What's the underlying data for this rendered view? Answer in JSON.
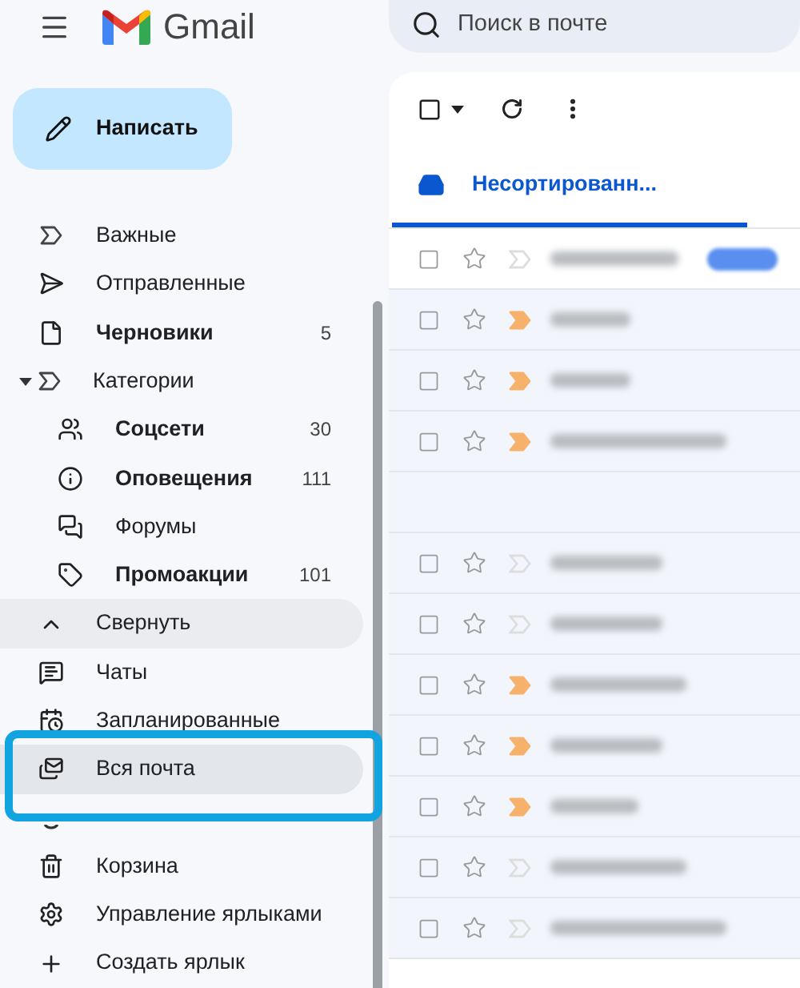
{
  "header": {
    "app_name": "Gmail",
    "search": {
      "placeholder": "Поиск в почте"
    }
  },
  "compose": {
    "label": "Написать"
  },
  "sidebar": {
    "items": [
      {
        "label": "Важные",
        "bold": false,
        "selected": false
      },
      {
        "label": "Отправленные",
        "bold": false,
        "selected": false
      },
      {
        "label": "Черновики",
        "bold": true,
        "count": "5",
        "selected": false
      },
      {
        "label": "Категории",
        "bold": false,
        "selected": false,
        "expanded": true,
        "children": [
          {
            "label": "Соцсети",
            "bold": true,
            "count": "30"
          },
          {
            "label": "Оповещения",
            "bold": true,
            "count": "111"
          },
          {
            "label": "Форумы",
            "bold": false
          },
          {
            "label": "Промоакции",
            "bold": true,
            "count": "101"
          }
        ]
      },
      {
        "label": "Свернуть",
        "bold": false,
        "selected": false,
        "hovered": true
      },
      {
        "label": "Чаты",
        "bold": false,
        "selected": false
      },
      {
        "label": "Запланированные",
        "bold": false,
        "selected": false
      },
      {
        "label": "Вся почта",
        "bold": false,
        "selected": true
      },
      {
        "kind": "covered"
      },
      {
        "label": "Корзина",
        "bold": false,
        "selected": false
      },
      {
        "label": "Управление ярлыками",
        "bold": false,
        "selected": false
      },
      {
        "label": "Создать ярлык",
        "bold": false,
        "selected": false
      }
    ]
  },
  "toolbar": {
    "select_all": {
      "checked": false
    }
  },
  "tabs": [
    {
      "label": "Несортированн...",
      "selected": true
    }
  ],
  "rows": [
    {
      "kind": "message",
      "unread": true,
      "important": false,
      "checked": false
    },
    {
      "kind": "message",
      "unread": false,
      "important": true,
      "checked": false
    },
    {
      "kind": "message",
      "unread": false,
      "important": true,
      "checked": false
    },
    {
      "kind": "message",
      "unread": false,
      "important": true,
      "checked": false
    },
    {
      "kind": "blank"
    },
    {
      "kind": "message",
      "unread": false,
      "important": false,
      "checked": false
    },
    {
      "kind": "message",
      "unread": false,
      "important": false,
      "checked": false
    },
    {
      "kind": "message",
      "unread": false,
      "important": true,
      "checked": false
    },
    {
      "kind": "message",
      "unread": false,
      "important": true,
      "checked": false
    },
    {
      "kind": "message",
      "unread": false,
      "important": true,
      "checked": false
    },
    {
      "kind": "message",
      "unread": false,
      "important": false,
      "checked": false
    },
    {
      "kind": "message",
      "unread": false,
      "important": false,
      "checked": false
    }
  ]
}
